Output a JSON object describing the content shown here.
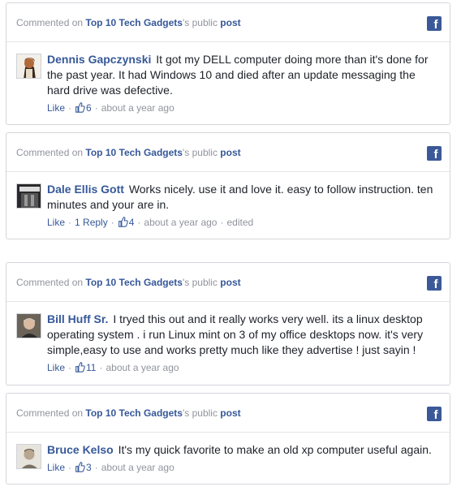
{
  "colors": {
    "link": "#365899",
    "muted": "#90949c",
    "fb_blue": "#3b5998",
    "border": "#d3d6db"
  },
  "cards": [
    {
      "header": {
        "prefix": "Commented on",
        "page": "Top 10 Tech Gadgets",
        "possessive": "'s public",
        "post": "post"
      },
      "author": "Dennis Gapczynski",
      "text": "It got my DELL computer doing more than it's done for the past year. It had Windows 10 and died after an update messaging the hard drive was defective.",
      "like": "Like",
      "likes": "6",
      "time": "about a year ago"
    },
    {
      "header": {
        "prefix": "Commented on",
        "page": "Top 10 Tech Gadgets",
        "possessive": "'s public",
        "post": "post"
      },
      "author": "Dale Ellis Gott",
      "text": "Works nicely. use it and love it. easy to follow instruction. ten minutes and your are in.",
      "like": "Like",
      "reply": "1 Reply",
      "likes": "4",
      "time": "about a year ago",
      "edited": "edited"
    },
    {
      "header": {
        "prefix": "Commented on",
        "page": "Top 10 Tech Gadgets",
        "possessive": "'s public",
        "post": "post"
      },
      "author": "Bill Huff Sr.",
      "text": "I tryed this out and it really works very well. its a linux desktop operating system . i run Linux mint on 3 of my office desktops now. it's very simple,easy to use and works pretty much like they advertise ! just sayin !",
      "like": "Like",
      "likes": "11",
      "time": "about a year ago"
    },
    {
      "header": {
        "prefix": "Commented on",
        "page": "Top 10 Tech Gadgets",
        "possessive": "'s public",
        "post": "post"
      },
      "author": "Bruce Kelso",
      "text": "It's my quick favorite to make an old xp computer useful again.",
      "like": "Like",
      "likes": "3",
      "time": "about a year ago"
    }
  ],
  "icons": {
    "facebook": "facebook-icon",
    "thumb": "thumbs-up-icon"
  }
}
